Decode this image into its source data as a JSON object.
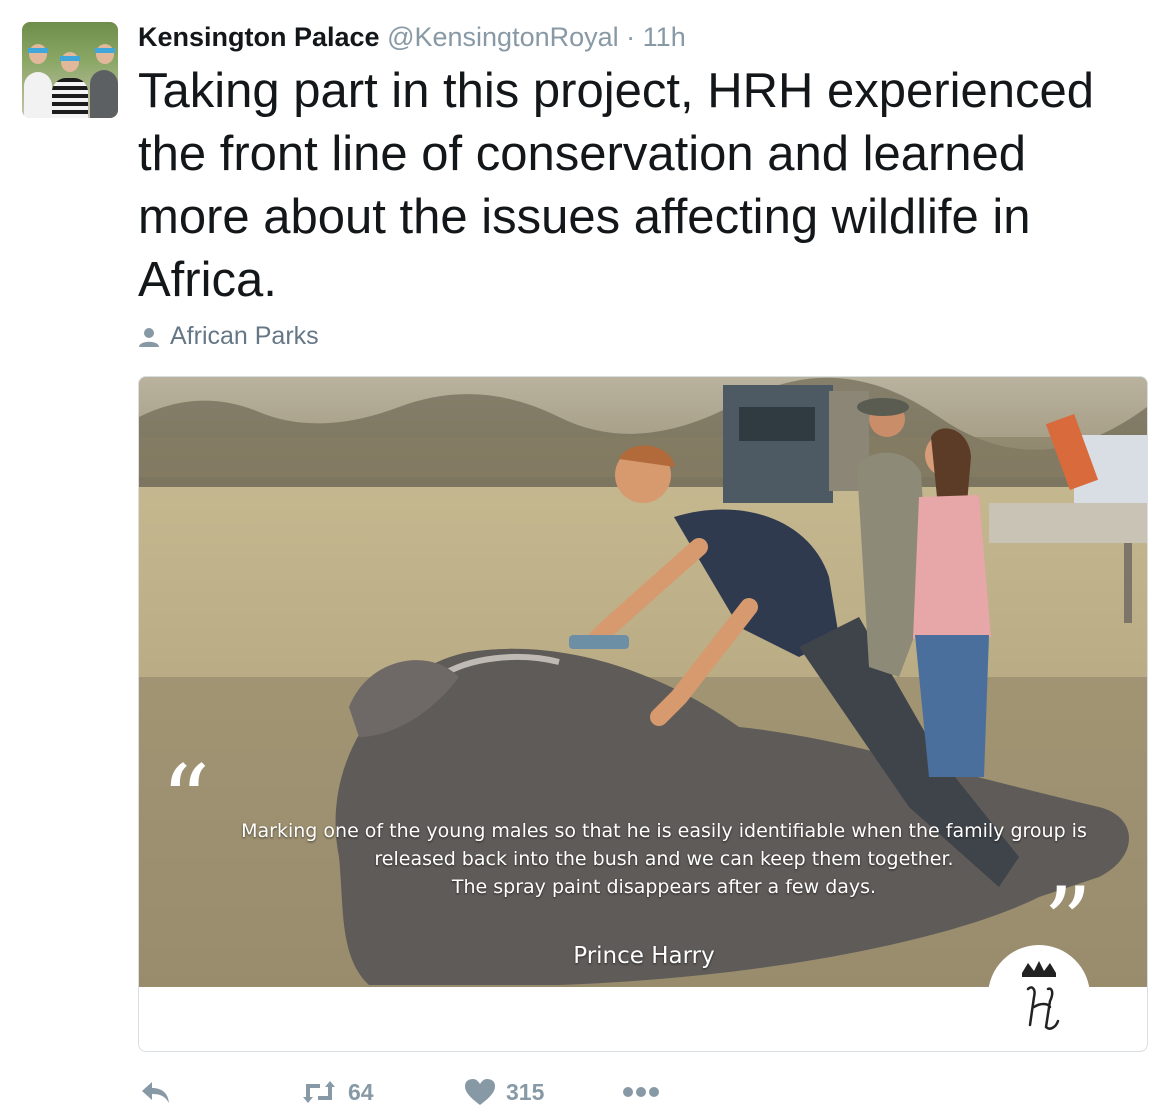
{
  "tweet": {
    "author_name": "Kensington Palace",
    "author_handle": "@KensingtonRoyal",
    "separator": "·",
    "time": "11h",
    "text": "Taking part in this project, HRH experienced the front line of conservation and learned more about the issues affecting wildlife in Africa.",
    "tagged_user": "African Parks"
  },
  "card": {
    "quote_lines": [
      "Marking one of the young males so that he is easily identifiable when the family group is",
      "released back into the bush and we can keep them together.",
      "The spray paint disappears after a few days."
    ],
    "attribution": "Prince Harry",
    "open_quote": "“",
    "close_quote": "”"
  },
  "actions": {
    "reply_icon": "reply-icon",
    "retweet_icon": "retweet-icon",
    "retweet_count": "64",
    "like_icon": "heart-icon",
    "like_count": "315",
    "more_icon": "more-icon"
  },
  "colors": {
    "text_primary": "#14171a",
    "text_secondary": "#8899a6",
    "border": "#d9dee2"
  }
}
